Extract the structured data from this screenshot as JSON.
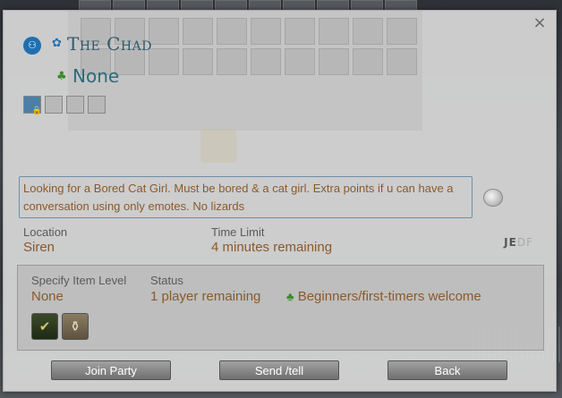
{
  "window": {
    "close_icon": "close-icon"
  },
  "player": {
    "role_icon": "party-role-icon",
    "name": "The Chad",
    "status": "None"
  },
  "comment": "Looking for a Bored Cat Girl. Must be bored & a cat girl. Extra points if u can have a conversation using only emotes. No lizards",
  "location": {
    "label": "Location",
    "value": "Siren"
  },
  "time_limit": {
    "label": "Time Limit",
    "value": "4 minutes remaining"
  },
  "world_logo": {
    "main": "JE",
    "faded": "DF"
  },
  "item_level": {
    "label": "Specify Item Level",
    "value": "None"
  },
  "status": {
    "label": "Status",
    "value": "1 player remaining",
    "tag": "Beginners/first-timers welcome"
  },
  "buttons": {
    "join": "Join Party",
    "tell": "Send /tell",
    "back": "Back"
  },
  "colors": {
    "accent_text": "#8a5a2c",
    "name_text": "#2e5a6b",
    "button": "#8a8a8a"
  }
}
